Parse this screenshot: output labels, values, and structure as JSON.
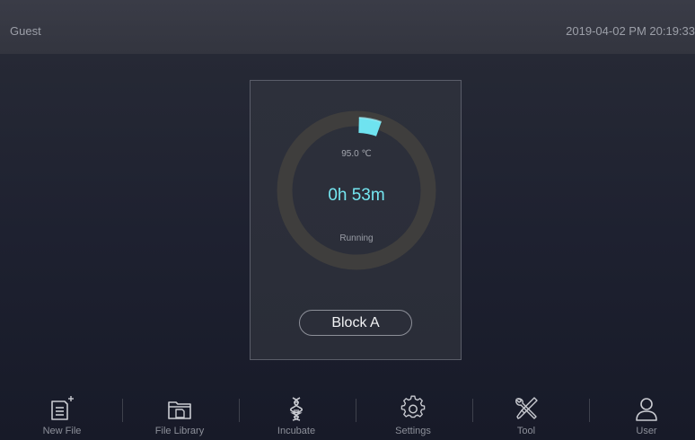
{
  "header": {
    "user": "Guest",
    "datetime": "2019-04-02 PM 20:19:33"
  },
  "block": {
    "temperature": "95.0 ℃",
    "time_remaining": "0h 53m",
    "status": "Running",
    "button_label": "Block A",
    "progress_indicator_color": "#6fe3f0",
    "ring_color": "#3f3e3d"
  },
  "nav": {
    "items": [
      {
        "label": "New File",
        "icon": "new-file-icon"
      },
      {
        "label": "File Library",
        "icon": "folder-icon"
      },
      {
        "label": "Incubate",
        "icon": "dna-icon"
      },
      {
        "label": "Settings",
        "icon": "gear-icon"
      },
      {
        "label": "Tool",
        "icon": "tools-icon"
      },
      {
        "label": "User",
        "icon": "user-icon"
      }
    ]
  },
  "colors": {
    "accent": "#74e6f0",
    "topbar": "#363842",
    "background": "#1c1e2a"
  }
}
